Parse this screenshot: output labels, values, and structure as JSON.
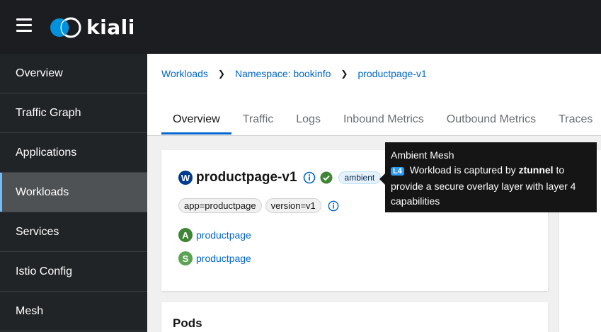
{
  "app": {
    "logo_text": "kiali"
  },
  "sidebar": {
    "items": [
      {
        "label": "Overview"
      },
      {
        "label": "Traffic Graph"
      },
      {
        "label": "Applications"
      },
      {
        "label": "Workloads"
      },
      {
        "label": "Services"
      },
      {
        "label": "Istio Config"
      },
      {
        "label": "Mesh"
      }
    ],
    "active": "Workloads"
  },
  "breadcrumb": {
    "items": [
      "Workloads",
      "Namespace: bookinfo",
      "productpage-v1"
    ]
  },
  "tabs": [
    "Overview",
    "Traffic",
    "Logs",
    "Inbound Metrics",
    "Outbound Metrics",
    "Traces"
  ],
  "workload": {
    "badge": "W",
    "name": "productpage-v1",
    "ambient_label": "ambient",
    "labels": [
      "app=productpage",
      "version=v1"
    ],
    "app": {
      "badge": "A",
      "name": "productpage"
    },
    "service": {
      "badge": "S",
      "name": "productpage"
    }
  },
  "pods": {
    "title": "Pods"
  },
  "tooltip": {
    "title": "Ambient Mesh",
    "badge": "L4",
    "text_before": "Workload is captured by",
    "bold": "ztunnel",
    "text_after": "to provide a secure overlay layer with layer 4 capabilities"
  },
  "colors": {
    "masthead": "#1b1d21",
    "sidebar": "#212427",
    "link": "#0066cc",
    "active_tab_underline": "#0066cc",
    "success": "#3e8635"
  }
}
